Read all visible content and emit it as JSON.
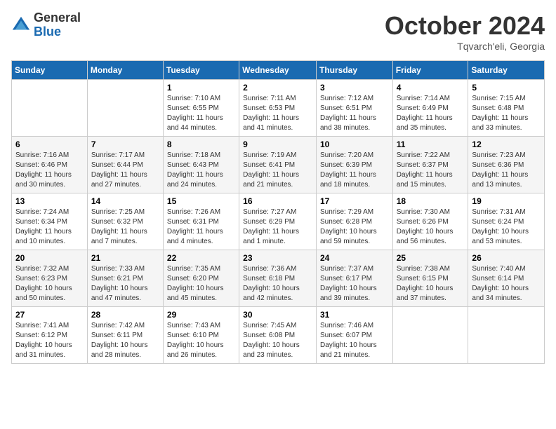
{
  "header": {
    "logo_general": "General",
    "logo_blue": "Blue",
    "month_title": "October 2024",
    "location": "Tqvarch'eli, Georgia"
  },
  "days_of_week": [
    "Sunday",
    "Monday",
    "Tuesday",
    "Wednesday",
    "Thursday",
    "Friday",
    "Saturday"
  ],
  "weeks": [
    [
      {
        "day": null,
        "content": null
      },
      {
        "day": null,
        "content": null
      },
      {
        "day": "1",
        "content": "Sunrise: 7:10 AM\nSunset: 6:55 PM\nDaylight: 11 hours and 44 minutes."
      },
      {
        "day": "2",
        "content": "Sunrise: 7:11 AM\nSunset: 6:53 PM\nDaylight: 11 hours and 41 minutes."
      },
      {
        "day": "3",
        "content": "Sunrise: 7:12 AM\nSunset: 6:51 PM\nDaylight: 11 hours and 38 minutes."
      },
      {
        "day": "4",
        "content": "Sunrise: 7:14 AM\nSunset: 6:49 PM\nDaylight: 11 hours and 35 minutes."
      },
      {
        "day": "5",
        "content": "Sunrise: 7:15 AM\nSunset: 6:48 PM\nDaylight: 11 hours and 33 minutes."
      }
    ],
    [
      {
        "day": "6",
        "content": "Sunrise: 7:16 AM\nSunset: 6:46 PM\nDaylight: 11 hours and 30 minutes."
      },
      {
        "day": "7",
        "content": "Sunrise: 7:17 AM\nSunset: 6:44 PM\nDaylight: 11 hours and 27 minutes."
      },
      {
        "day": "8",
        "content": "Sunrise: 7:18 AM\nSunset: 6:43 PM\nDaylight: 11 hours and 24 minutes."
      },
      {
        "day": "9",
        "content": "Sunrise: 7:19 AM\nSunset: 6:41 PM\nDaylight: 11 hours and 21 minutes."
      },
      {
        "day": "10",
        "content": "Sunrise: 7:20 AM\nSunset: 6:39 PM\nDaylight: 11 hours and 18 minutes."
      },
      {
        "day": "11",
        "content": "Sunrise: 7:22 AM\nSunset: 6:37 PM\nDaylight: 11 hours and 15 minutes."
      },
      {
        "day": "12",
        "content": "Sunrise: 7:23 AM\nSunset: 6:36 PM\nDaylight: 11 hours and 13 minutes."
      }
    ],
    [
      {
        "day": "13",
        "content": "Sunrise: 7:24 AM\nSunset: 6:34 PM\nDaylight: 11 hours and 10 minutes."
      },
      {
        "day": "14",
        "content": "Sunrise: 7:25 AM\nSunset: 6:32 PM\nDaylight: 11 hours and 7 minutes."
      },
      {
        "day": "15",
        "content": "Sunrise: 7:26 AM\nSunset: 6:31 PM\nDaylight: 11 hours and 4 minutes."
      },
      {
        "day": "16",
        "content": "Sunrise: 7:27 AM\nSunset: 6:29 PM\nDaylight: 11 hours and 1 minute."
      },
      {
        "day": "17",
        "content": "Sunrise: 7:29 AM\nSunset: 6:28 PM\nDaylight: 10 hours and 59 minutes."
      },
      {
        "day": "18",
        "content": "Sunrise: 7:30 AM\nSunset: 6:26 PM\nDaylight: 10 hours and 56 minutes."
      },
      {
        "day": "19",
        "content": "Sunrise: 7:31 AM\nSunset: 6:24 PM\nDaylight: 10 hours and 53 minutes."
      }
    ],
    [
      {
        "day": "20",
        "content": "Sunrise: 7:32 AM\nSunset: 6:23 PM\nDaylight: 10 hours and 50 minutes."
      },
      {
        "day": "21",
        "content": "Sunrise: 7:33 AM\nSunset: 6:21 PM\nDaylight: 10 hours and 47 minutes."
      },
      {
        "day": "22",
        "content": "Sunrise: 7:35 AM\nSunset: 6:20 PM\nDaylight: 10 hours and 45 minutes."
      },
      {
        "day": "23",
        "content": "Sunrise: 7:36 AM\nSunset: 6:18 PM\nDaylight: 10 hours and 42 minutes."
      },
      {
        "day": "24",
        "content": "Sunrise: 7:37 AM\nSunset: 6:17 PM\nDaylight: 10 hours and 39 minutes."
      },
      {
        "day": "25",
        "content": "Sunrise: 7:38 AM\nSunset: 6:15 PM\nDaylight: 10 hours and 37 minutes."
      },
      {
        "day": "26",
        "content": "Sunrise: 7:40 AM\nSunset: 6:14 PM\nDaylight: 10 hours and 34 minutes."
      }
    ],
    [
      {
        "day": "27",
        "content": "Sunrise: 7:41 AM\nSunset: 6:12 PM\nDaylight: 10 hours and 31 minutes."
      },
      {
        "day": "28",
        "content": "Sunrise: 7:42 AM\nSunset: 6:11 PM\nDaylight: 10 hours and 28 minutes."
      },
      {
        "day": "29",
        "content": "Sunrise: 7:43 AM\nSunset: 6:10 PM\nDaylight: 10 hours and 26 minutes."
      },
      {
        "day": "30",
        "content": "Sunrise: 7:45 AM\nSunset: 6:08 PM\nDaylight: 10 hours and 23 minutes."
      },
      {
        "day": "31",
        "content": "Sunrise: 7:46 AM\nSunset: 6:07 PM\nDaylight: 10 hours and 21 minutes."
      },
      {
        "day": null,
        "content": null
      },
      {
        "day": null,
        "content": null
      }
    ]
  ]
}
